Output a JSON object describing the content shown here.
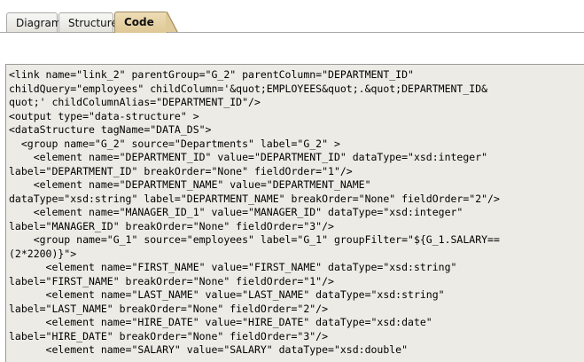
{
  "tabs": [
    {
      "label": "Diagram",
      "selected": false
    },
    {
      "label": "Structure",
      "selected": false
    },
    {
      "label": "Code",
      "selected": true
    }
  ],
  "code_lines": [
    "<link name=\"link_2\" parentGroup=\"G_2\" parentColumn=\"DEPARTMENT_ID\"",
    "childQuery=\"employees\" childColumn='&quot;EMPLOYEES&quot;.&quot;DEPARTMENT_ID&",
    "quot;' childColumnAlias=\"DEPARTMENT_ID\"/>",
    "<output type=\"data-structure\" >",
    "<dataStructure tagName=\"DATA_DS\">",
    "  <group name=\"G_2\" source=\"Departments\" label=\"G_2\" >",
    "    <element name=\"DEPARTMENT_ID\" value=\"DEPARTMENT_ID\" dataType=\"xsd:integer\"",
    "label=\"DEPARTMENT_ID\" breakOrder=\"None\" fieldOrder=\"1\"/>",
    "    <element name=\"DEPARTMENT_NAME\" value=\"DEPARTMENT_NAME\"",
    "dataType=\"xsd:string\" label=\"DEPARTMENT_NAME\" breakOrder=\"None\" fieldOrder=\"2\"/>",
    "    <element name=\"MANAGER_ID_1\" value=\"MANAGER_ID\" dataType=\"xsd:integer\"",
    "label=\"MANAGER_ID\" breakOrder=\"None\" fieldOrder=\"3\"/>",
    "    <group name=\"G_1\" source=\"employees\" label=\"G_1\" groupFilter=\"${G_1.SALARY==",
    "(2*2200)}\">",
    "      <element name=\"FIRST_NAME\" value=\"FIRST_NAME\" dataType=\"xsd:string\"",
    "label=\"FIRST_NAME\" breakOrder=\"None\" fieldOrder=\"1\"/>",
    "      <element name=\"LAST_NAME\" value=\"LAST_NAME\" dataType=\"xsd:string\"",
    "label=\"LAST_NAME\" breakOrder=\"None\" fieldOrder=\"2\"/>",
    "      <element name=\"HIRE_DATE\" value=\"HIRE_DATE\" dataType=\"xsd:date\"",
    "label=\"HIRE_DATE\" breakOrder=\"None\" fieldOrder=\"3\"/>",
    "      <element name=\"SALARY\" value=\"SALARY\" dataType=\"xsd:double\""
  ],
  "colors": {
    "code_background": "#ecebe5",
    "active_tab": "#e6d3a6",
    "inactive_tab": "#eeede8"
  }
}
